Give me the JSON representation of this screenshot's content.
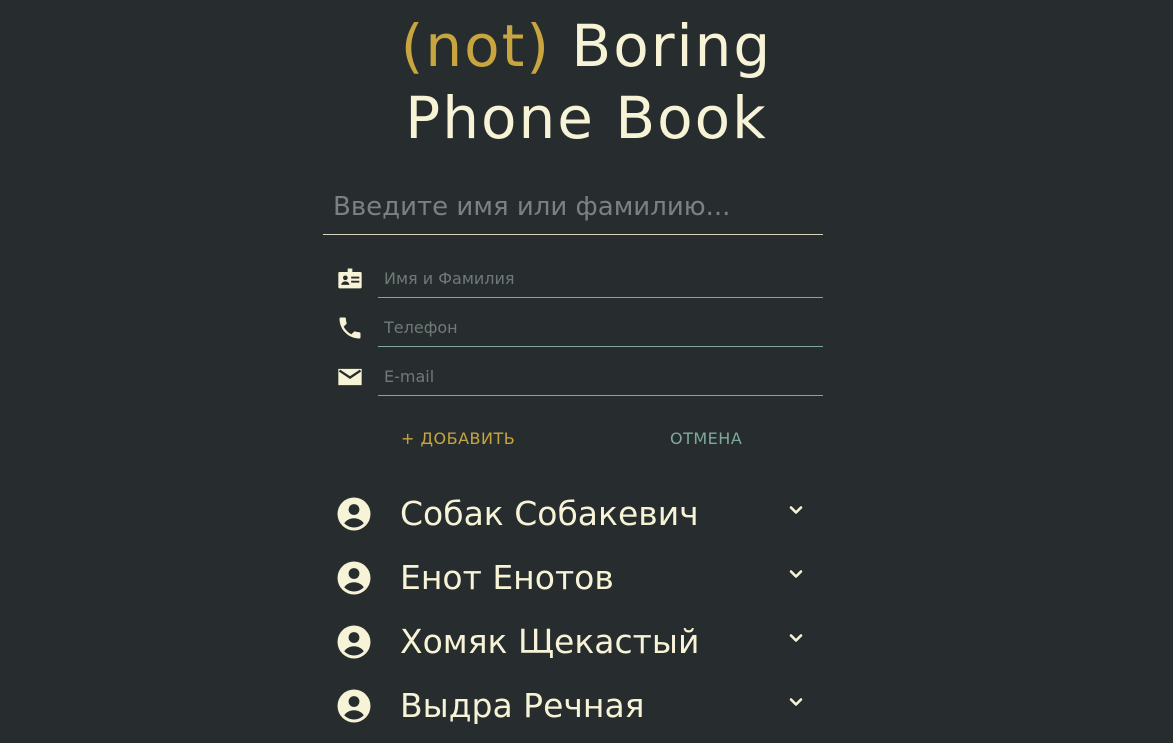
{
  "header": {
    "title_accent": "(not)",
    "title_rest": " Boring",
    "title_line2": "Phone Book"
  },
  "search": {
    "placeholder": "Введите имя или фамилию..."
  },
  "form": {
    "name_placeholder": "Имя и Фамилия",
    "phone_placeholder": "Телефон",
    "email_placeholder": "E-mail",
    "add_label": "+ ДОБАВИТЬ",
    "cancel_label": "ОТМЕНА"
  },
  "contacts": [
    {
      "name": "Собак Собакевич"
    },
    {
      "name": "Енот Енотов"
    },
    {
      "name": "Хомяк Щекастый"
    },
    {
      "name": "Выдра Речная"
    }
  ],
  "colors": {
    "background": "#272d2e",
    "text": "#f7f3d6",
    "accent": "#c9a53f",
    "secondary": "#7fa99b"
  },
  "icons": {
    "name_field": "contact-card-icon",
    "phone_field": "phone-icon",
    "email_field": "mail-icon",
    "contact": "account-circle-icon",
    "expand": "chevron-down-icon"
  }
}
